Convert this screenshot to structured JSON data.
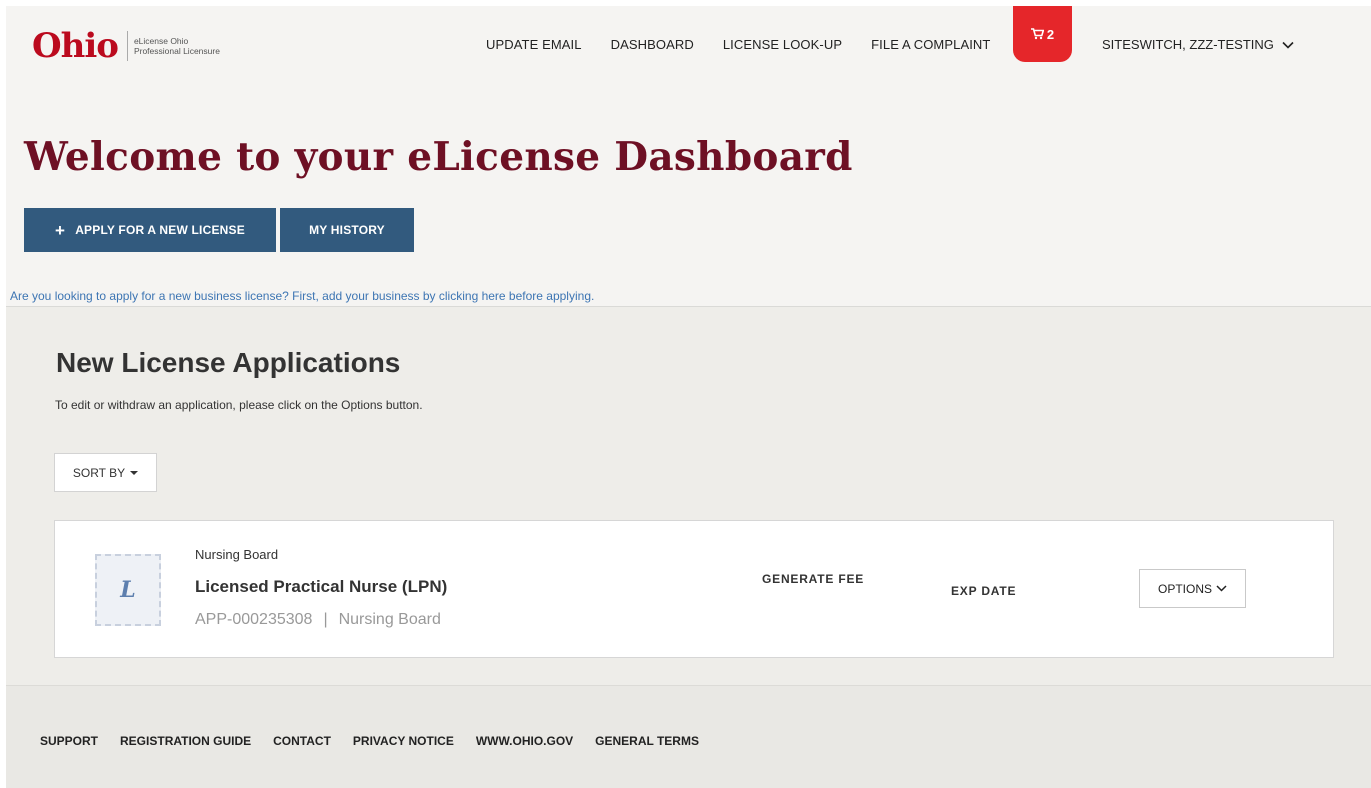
{
  "header": {
    "logo_word": "Ohio",
    "logo_sub_line1": "eLicense Ohio",
    "logo_sub_line2": "Professional Licensure",
    "nav": {
      "update_email": "UPDATE EMAIL",
      "dashboard": "DASHBOARD",
      "license_lookup": "LICENSE LOOK-UP",
      "file_complaint": "FILE A COMPLAINT"
    },
    "cart_count": "2",
    "user_name": "SITESWITCH, ZZZ-TESTING"
  },
  "welcome": {
    "title": "Welcome to your eLicense Dashboard",
    "apply_label": "APPLY FOR A NEW LICENSE",
    "history_label": "MY HISTORY",
    "business_link": "Are you looking to apply for a new business license? First, add your business by clicking here before applying."
  },
  "applications": {
    "title": "New License Applications",
    "subtitle": "To edit or withdraw an application, please click on the Options button.",
    "sort_label": "SORT BY",
    "items": [
      {
        "board": "Nursing Board",
        "license": "Licensed Practical Nurse (LPN)",
        "app_id": "APP-000235308",
        "separator": "|",
        "board_meta": "Nursing Board",
        "icon_glyph": "L",
        "fee_label": "GENERATE FEE",
        "exp_label": "EXP DATE",
        "options_label": "OPTIONS"
      }
    ]
  },
  "footer": {
    "links": [
      "SUPPORT",
      "REGISTRATION GUIDE",
      "CONTACT",
      "PRIVACY NOTICE",
      "WWW.OHIO.GOV",
      "GENERAL TERMS"
    ]
  },
  "colors": {
    "brand_red": "#bb0a1e",
    "title_maroon": "#6e1024",
    "button_blue": "#325a7e",
    "link_blue": "#3d75b3",
    "cart_red": "#e5262a"
  }
}
